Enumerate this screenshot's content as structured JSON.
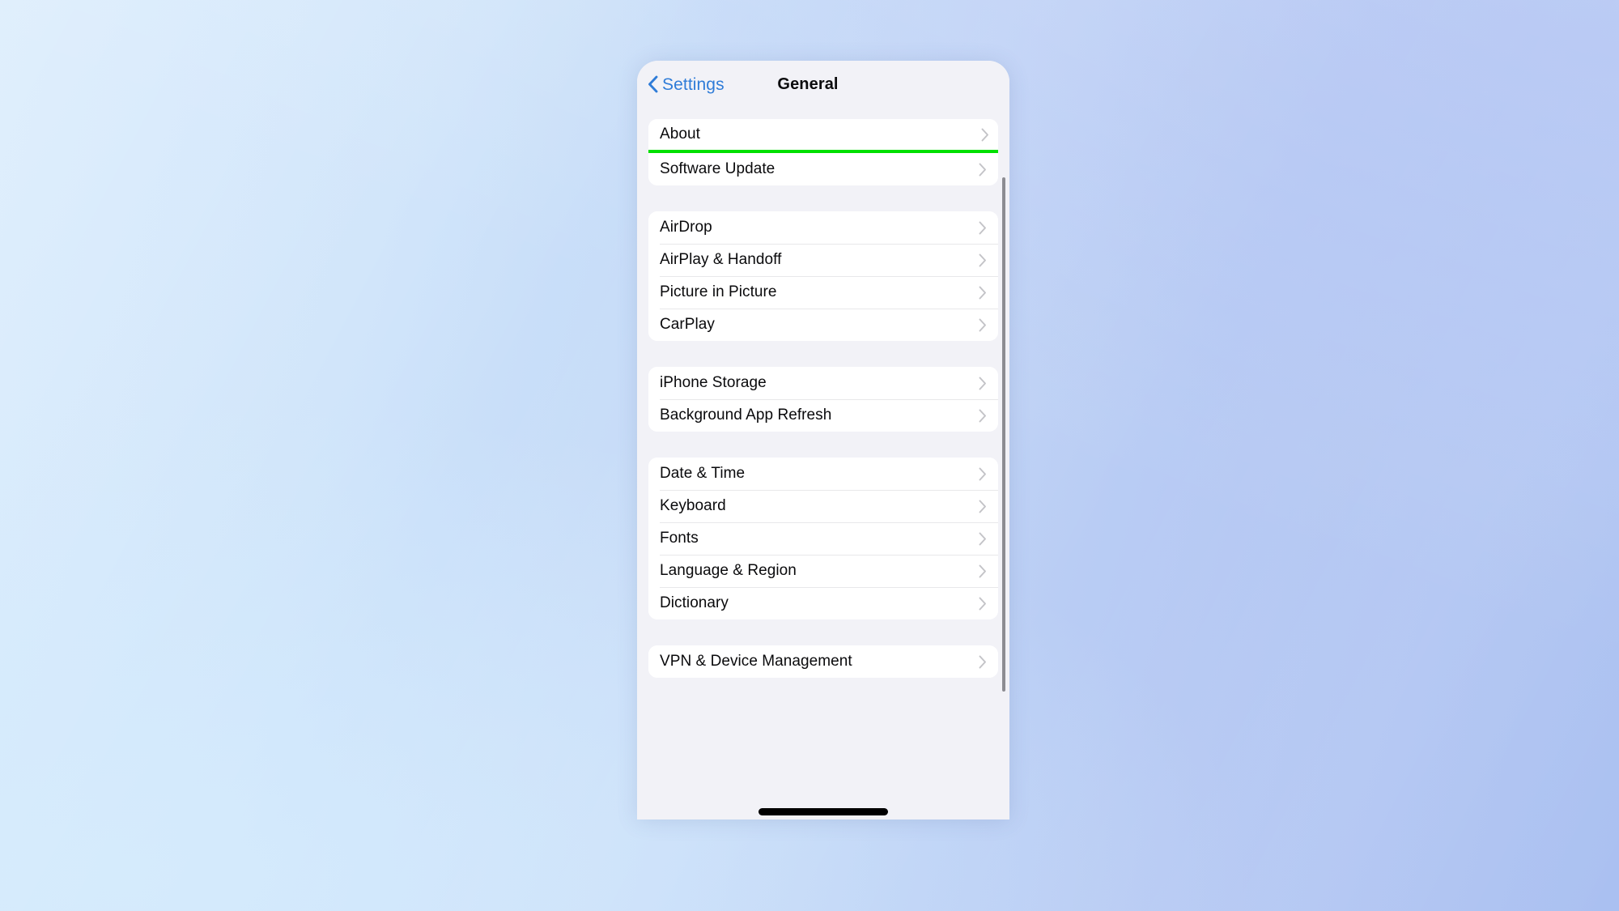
{
  "background": {
    "name": "ios-wallpaper-blue-gradient",
    "colors": [
      "#d2e8fb",
      "#c2d7f7",
      "#aac0f1"
    ]
  },
  "phone": {
    "navbar": {
      "back_label": "Settings",
      "back_icon": "chevron-left-icon",
      "title": "General"
    },
    "highlight": {
      "target": "About",
      "color": "#00e000"
    },
    "home_indicator_label": "",
    "scrollbar": {
      "visible": true,
      "color": "#8c8c92"
    },
    "groups": [
      {
        "id": "group-0",
        "rows": [
          {
            "label": "About",
            "chevron": "chevron-right-icon",
            "highlighted": true
          },
          {
            "label": "Software Update",
            "chevron": "chevron-right-icon",
            "highlighted": false
          }
        ]
      },
      {
        "id": "group-1",
        "rows": [
          {
            "label": "AirDrop",
            "chevron": "chevron-right-icon",
            "highlighted": false
          },
          {
            "label": "AirPlay & Handoff",
            "chevron": "chevron-right-icon",
            "highlighted": false
          },
          {
            "label": "Picture in Picture",
            "chevron": "chevron-right-icon",
            "highlighted": false
          },
          {
            "label": "CarPlay",
            "chevron": "chevron-right-icon",
            "highlighted": false
          }
        ]
      },
      {
        "id": "group-2",
        "rows": [
          {
            "label": "iPhone Storage",
            "chevron": "chevron-right-icon",
            "highlighted": false
          },
          {
            "label": "Background App Refresh",
            "chevron": "chevron-right-icon",
            "highlighted": false
          }
        ]
      },
      {
        "id": "group-3",
        "rows": [
          {
            "label": "Date & Time",
            "chevron": "chevron-right-icon",
            "highlighted": false
          },
          {
            "label": "Keyboard",
            "chevron": "chevron-right-icon",
            "highlighted": false
          },
          {
            "label": "Fonts",
            "chevron": "chevron-right-icon",
            "highlighted": false
          },
          {
            "label": "Language & Region",
            "chevron": "chevron-right-icon",
            "highlighted": false
          },
          {
            "label": "Dictionary",
            "chevron": "chevron-right-icon",
            "highlighted": false
          }
        ]
      },
      {
        "id": "group-4",
        "rows": [
          {
            "label": "VPN & Device Management",
            "chevron": "chevron-right-icon",
            "highlighted": false
          }
        ]
      }
    ]
  }
}
